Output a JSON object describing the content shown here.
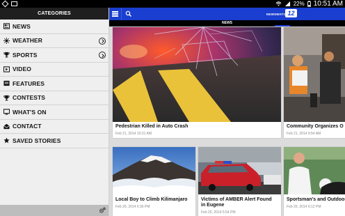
{
  "status_bar": {
    "battery": "22%",
    "time": "10:51 AM"
  },
  "sidebar": {
    "header": "CATEGORIES",
    "items": [
      {
        "label": "NEWS",
        "icon": "newspaper-icon",
        "has_chevron": false
      },
      {
        "label": "WEATHER",
        "icon": "sun-icon",
        "has_chevron": true
      },
      {
        "label": "SPORTS",
        "icon": "trophy-icon",
        "has_chevron": true
      },
      {
        "label": "VIDEO",
        "icon": "video-icon",
        "has_chevron": false
      },
      {
        "label": "FEATURES",
        "icon": "document-icon",
        "has_chevron": false
      },
      {
        "label": "CONTESTS",
        "icon": "trophy-icon",
        "has_chevron": false
      },
      {
        "label": "WHAT'S ON",
        "icon": "tv-icon",
        "has_chevron": false
      },
      {
        "label": "CONTACT",
        "icon": "envelope-icon",
        "has_chevron": false
      },
      {
        "label": "SAVED STORIES",
        "icon": "star-icon",
        "has_chevron": false
      }
    ]
  },
  "appbar": {
    "logo_word": "NEWSWATCH",
    "logo_number": "12"
  },
  "section": {
    "title": "NEWS"
  },
  "stories": [
    {
      "headline": "Pedestrian Killed in Auto Crash",
      "date": "Feb 21, 2014 10:31 AM"
    },
    {
      "headline": "Community Organizes O",
      "date": "Feb 21, 2014 9:54 AM"
    },
    {
      "headline": "Local Boy to Climb Kilimanjaro",
      "date": "Feb 20, 2014 6:36 PM"
    },
    {
      "headline_line1": "Victims of AMBER Alert Found",
      "headline_line2": "in Eugene",
      "date": "Feb 20, 2014 5:54 PM"
    },
    {
      "headline": "Sportsman's and Outdoor",
      "date": "Feb 20, 2014 6:12 PM"
    }
  ],
  "colors": {
    "brand_blue": "#1a3ecf",
    "sidebar_bg": "#efefef",
    "content_bg": "#dcdcdc"
  }
}
